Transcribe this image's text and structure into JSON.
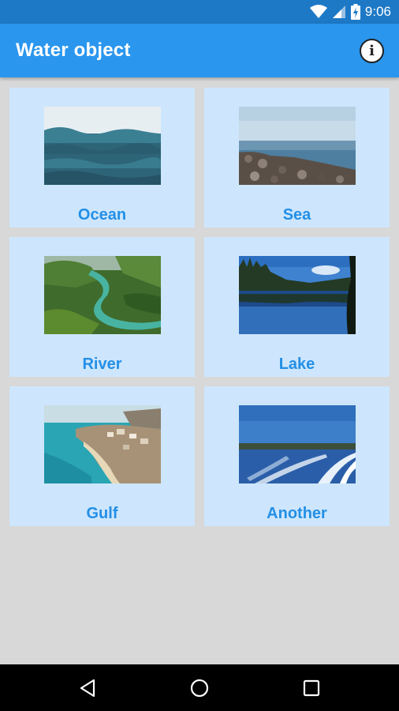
{
  "status_bar": {
    "time": "9:06"
  },
  "app_bar": {
    "title": "Water object",
    "info_icon": "info-icon"
  },
  "cards": [
    {
      "label": "Ocean",
      "image": "ocean-photo"
    },
    {
      "label": "Sea",
      "image": "sea-photo"
    },
    {
      "label": "River",
      "image": "river-photo"
    },
    {
      "label": "Lake",
      "image": "lake-photo"
    },
    {
      "label": "Gulf",
      "image": "gulf-photo"
    },
    {
      "label": "Another",
      "image": "boat-wake-photo"
    }
  ],
  "nav_bar": {
    "back": "back-icon",
    "home": "home-icon",
    "recents": "recents-icon"
  },
  "colors": {
    "status_bar": "#1d79c6",
    "app_bar": "#2a96ee",
    "card_bg": "#cde6fd",
    "card_label": "#238fe6",
    "page_bg": "#d8d8d8"
  }
}
